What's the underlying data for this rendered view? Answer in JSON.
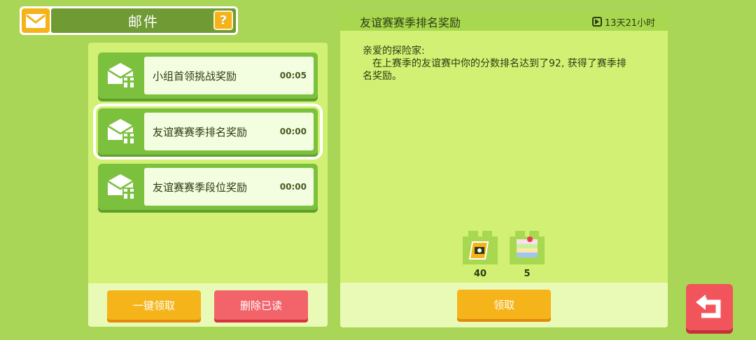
{
  "header": {
    "title": "邮件",
    "help_label": "?"
  },
  "mail_list": [
    {
      "title": "小组首领挑战奖励",
      "time": "00:05",
      "selected": false
    },
    {
      "title": "友谊赛赛季排名奖励",
      "time": "00:00",
      "selected": true
    },
    {
      "title": "友谊赛赛季段位奖励",
      "time": "00:00",
      "selected": false
    }
  ],
  "actions": {
    "claim_all": "一键领取",
    "delete_read": "删除已读"
  },
  "detail": {
    "title": "友谊赛赛季排名奖励",
    "remaining": "13天21小时",
    "greeting": "亲爱的探险家:",
    "body": "在上赛季的友谊赛中你的分数排名达到了92, 获得了赛季排名奖励。",
    "rewards": [
      {
        "item": "ticket-icon",
        "qty": "40"
      },
      {
        "item": "cake-icon",
        "qty": "5"
      }
    ],
    "claim": "领取"
  },
  "colors": {
    "background": "#a9d656",
    "accent_orange": "#f6b41b",
    "accent_red": "#f2636a",
    "panel": "#d2f174"
  }
}
